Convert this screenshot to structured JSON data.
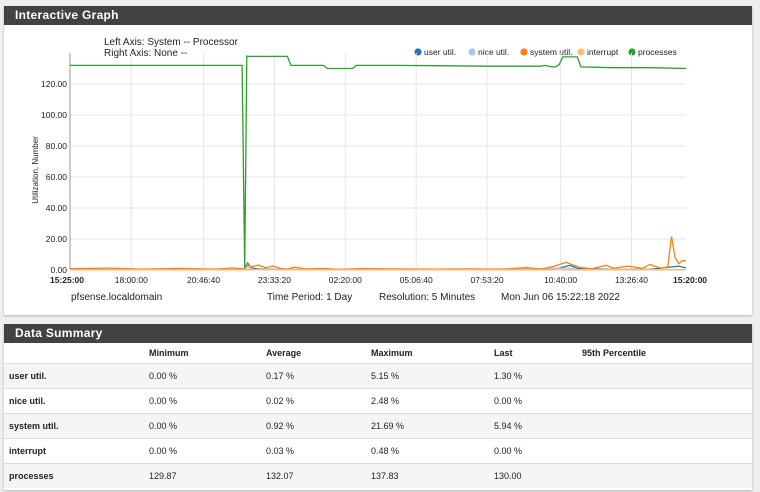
{
  "graph_panel": {
    "title": "Interactive Graph"
  },
  "graph": {
    "left_axis": "Left Axis: System -- Processor",
    "right_axis": "Right Axis: None --",
    "ylabel": "Utilization, Number",
    "footer": {
      "host": "pfsense.localdomain",
      "period": "Time Period: 1 Day",
      "resolution": "Resolution: 5 Minutes",
      "timestamp": "Mon Jun 06 15:22:18 2022"
    }
  },
  "chart_data": {
    "type": "line",
    "ylabel": "Utilization, Number",
    "ylim": [
      0,
      140
    ],
    "yticks": [
      "0.00",
      "20.00",
      "40.00",
      "60.00",
      "80.00",
      "100.00",
      "120.00"
    ],
    "xticks": [
      "15:25:00",
      "18:00:00",
      "20:46:40",
      "23:33:20",
      "02:20:00",
      "05:06:40",
      "07:53:20",
      "10:40:00",
      "13:26:40",
      "15:20:00"
    ],
    "legend_position": "top-right",
    "grid": true,
    "series": [
      {
        "name": "user util.",
        "color": "#1f77b4",
        "points": [
          [
            0,
            0.3
          ],
          [
            20,
            0.2
          ],
          [
            30,
            0.3
          ],
          [
            40,
            0.2
          ],
          [
            48,
            0.3
          ],
          [
            49,
            4.5
          ],
          [
            50,
            1.5
          ],
          [
            52,
            0.5
          ],
          [
            60,
            0.3
          ],
          [
            70,
            0.4
          ],
          [
            80,
            0.2
          ],
          [
            90,
            0.3
          ],
          [
            100,
            0.2
          ],
          [
            110,
            0.3
          ],
          [
            120,
            0.2
          ],
          [
            130,
            0.3
          ],
          [
            135,
            1.2
          ],
          [
            138,
            3
          ],
          [
            140,
            1
          ],
          [
            150,
            0.3
          ],
          [
            160,
            0.4
          ],
          [
            168,
            2.5
          ],
          [
            170,
            1.3
          ]
        ]
      },
      {
        "name": "nice util.",
        "color": "#aec7e8",
        "points": [
          [
            0,
            0.1
          ],
          [
            48,
            0.1
          ],
          [
            49,
            2.4
          ],
          [
            50,
            0.2
          ],
          [
            100,
            0.1
          ],
          [
            138,
            1.2
          ],
          [
            140,
            0.1
          ],
          [
            170,
            0.1
          ]
        ]
      },
      {
        "name": "system util.",
        "color": "#ff7f0e",
        "points": [
          [
            0,
            0.8
          ],
          [
            10,
            1.2
          ],
          [
            20,
            0.6
          ],
          [
            30,
            1
          ],
          [
            40,
            0.5
          ],
          [
            45,
            1.3
          ],
          [
            48,
            0.7
          ],
          [
            49,
            3.5
          ],
          [
            50,
            2
          ],
          [
            52,
            3.2
          ],
          [
            54,
            1.5
          ],
          [
            56,
            2.6
          ],
          [
            58,
            1
          ],
          [
            60,
            0.6
          ],
          [
            62,
            1.8
          ],
          [
            65,
            0.7
          ],
          [
            70,
            1
          ],
          [
            74,
            0.4
          ],
          [
            80,
            0.9
          ],
          [
            90,
            0.7
          ],
          [
            100,
            0.6
          ],
          [
            110,
            0.7
          ],
          [
            120,
            0.6
          ],
          [
            126,
            1.5
          ],
          [
            130,
            0.6
          ],
          [
            133,
            2
          ],
          [
            135,
            3.5
          ],
          [
            137,
            5
          ],
          [
            139,
            3
          ],
          [
            141,
            1.5
          ],
          [
            144,
            0.8
          ],
          [
            148,
            3
          ],
          [
            150,
            1
          ],
          [
            154,
            2.5
          ],
          [
            158,
            1
          ],
          [
            160,
            3.5
          ],
          [
            163,
            1.2
          ],
          [
            165,
            2
          ],
          [
            166,
            21.7
          ],
          [
            167,
            8
          ],
          [
            168,
            4
          ],
          [
            169,
            6
          ],
          [
            170,
            5.9
          ]
        ]
      },
      {
        "name": "interrupt",
        "color": "#ffbb78",
        "points": [
          [
            0,
            0.1
          ],
          [
            48,
            0.1
          ],
          [
            49,
            0.48
          ],
          [
            50,
            0.1
          ],
          [
            170,
            0.1
          ]
        ]
      },
      {
        "name": "processes",
        "color": "#2ca02c",
        "points": [
          [
            0,
            132
          ],
          [
            47,
            132
          ],
          [
            47.5,
            132
          ],
          [
            48.2,
            1
          ],
          [
            48.8,
            138
          ],
          [
            49.5,
            137.8
          ],
          [
            60,
            137.8
          ],
          [
            61,
            132
          ],
          [
            70,
            132
          ],
          [
            71,
            130
          ],
          [
            78,
            130
          ],
          [
            79,
            132
          ],
          [
            90,
            132
          ],
          [
            100,
            131.8
          ],
          [
            115,
            131.5
          ],
          [
            130,
            131.5
          ],
          [
            131,
            132
          ],
          [
            133,
            131
          ],
          [
            134,
            131
          ],
          [
            135,
            132.5
          ],
          [
            136,
            137.5
          ],
          [
            140,
            137.5
          ],
          [
            141,
            131
          ],
          [
            150,
            130.5
          ],
          [
            160,
            130.5
          ],
          [
            170,
            130
          ]
        ]
      }
    ]
  },
  "summary_panel": {
    "title": "Data Summary"
  },
  "summary": {
    "headers": {
      "minimum": "Minimum",
      "average": "Average",
      "maximum": "Maximum",
      "last": "Last",
      "p95": "95th Percentile"
    },
    "rows": [
      {
        "name": "user util.",
        "minimum": "0.00 %",
        "average": "0.17 %",
        "maximum": "5.15 %",
        "last": "1.30 %",
        "p95": ""
      },
      {
        "name": "nice util.",
        "minimum": "0.00 %",
        "average": "0.02 %",
        "maximum": "2.48 %",
        "last": "0.00 %",
        "p95": ""
      },
      {
        "name": "system util.",
        "minimum": "0.00 %",
        "average": "0.92 %",
        "maximum": "21.69 %",
        "last": "5.94 %",
        "p95": ""
      },
      {
        "name": "interrupt",
        "minimum": "0.00 %",
        "average": "0.03 %",
        "maximum": "0.48 %",
        "last": "0.00 %",
        "p95": ""
      },
      {
        "name": "processes",
        "minimum": "129.87",
        "average": "132.07",
        "maximum": "137.83",
        "last": "130.00",
        "p95": ""
      }
    ]
  }
}
